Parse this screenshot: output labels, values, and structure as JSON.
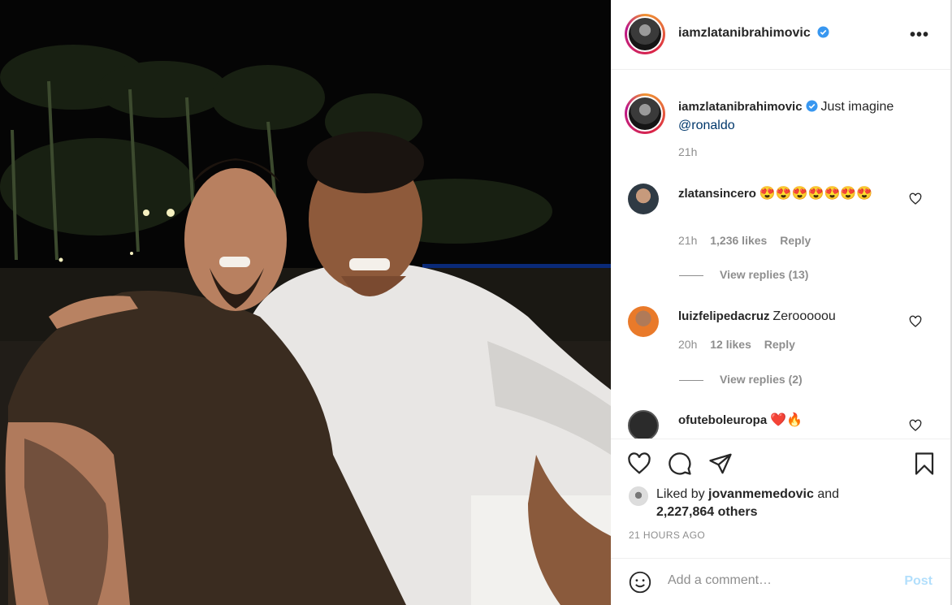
{
  "post": {
    "author": "iamzlatanibrahimovic",
    "caption_text": "Just imagine",
    "caption_mention": "@ronaldo",
    "caption_age": "21h",
    "menu_icon": "more-horizontal-icon"
  },
  "comments": [
    {
      "user": "zlatansincero",
      "text": "😍😍😍😍😍😍😍",
      "age": "21h",
      "likes": "1,236 likes",
      "reply_label": "Reply",
      "view_replies": "View replies (13)"
    },
    {
      "user": "luizfelipedacruz",
      "text": "Zerooooou",
      "age": "20h",
      "likes": "12 likes",
      "reply_label": "Reply",
      "view_replies": "View replies (2)"
    },
    {
      "user": "ofuteboleuropa",
      "text": "❤️🔥"
    }
  ],
  "likes": {
    "prefix": "Liked by",
    "user": "jovanmemedovic",
    "joiner": "and",
    "others": "2,227,864 others"
  },
  "timestamp": "21 HOURS AGO",
  "add_comment": {
    "placeholder": "Add a comment…",
    "post_label": "Post"
  },
  "colors": {
    "verified": "#3897f0",
    "heart_red": "#ed4956",
    "post_disabled": "#b2dffc",
    "link": "#00376b",
    "secondary_text": "#8e8e8e"
  }
}
